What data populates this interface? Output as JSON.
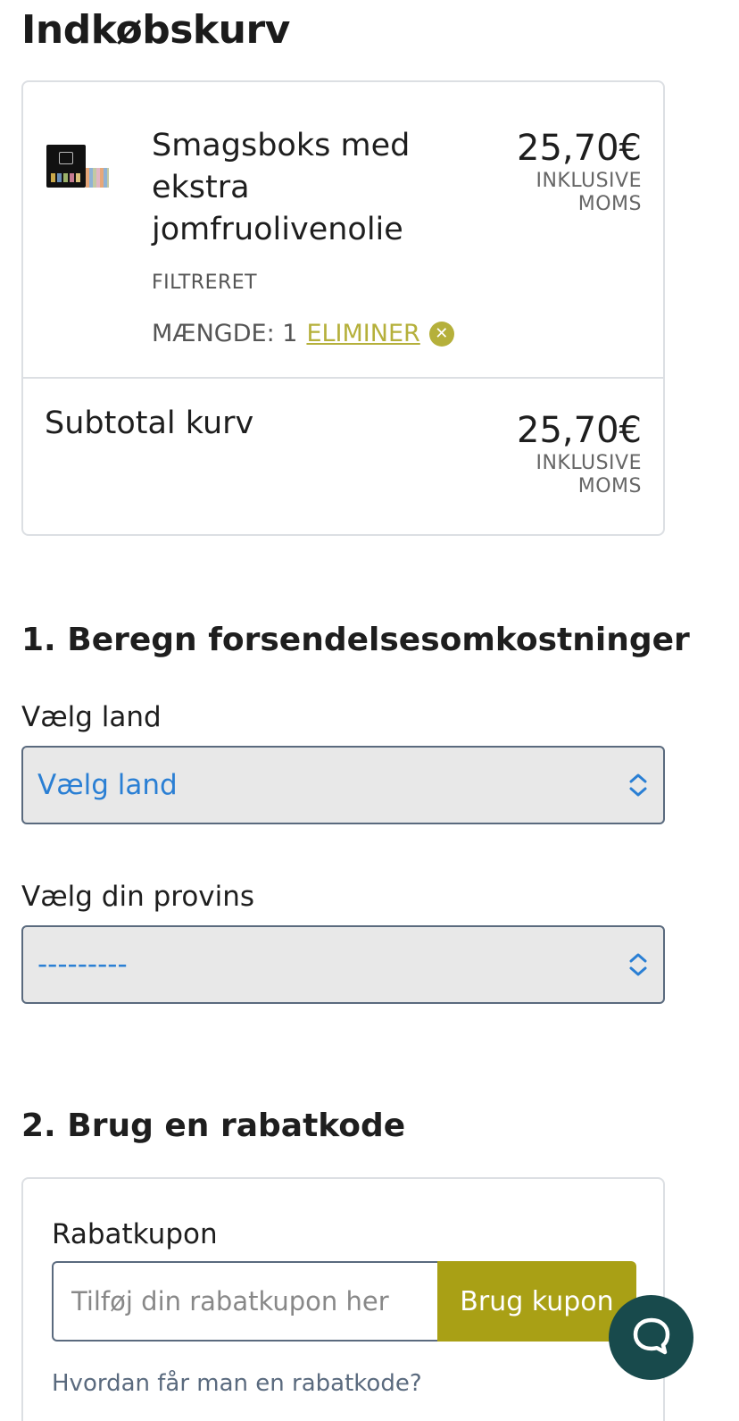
{
  "page": {
    "title": "Indkøbskurv"
  },
  "cart": {
    "item": {
      "name": "Smagsboks med ekstra jomfruolivenolie",
      "variant": "FILTRERET",
      "quantity_label": "MÆNGDE: 1",
      "remove_label": "ELIMINER",
      "price": "25,70€",
      "price_note": "INKLUSIVE MOMS"
    },
    "subtotal": {
      "label": "Subtotal kurv",
      "price": "25,70€",
      "price_note": "INKLUSIVE MOMS"
    }
  },
  "shipping": {
    "title": "1. Beregn forsendelsesomkostninger",
    "country_label": "Vælg land",
    "country_value": "Vælg land",
    "province_label": "Vælg din provins",
    "province_value": "---------"
  },
  "discount": {
    "title": "2. Brug en rabatkode",
    "coupon_label": "Rabatkupon",
    "coupon_placeholder": "Tilføj din rabatkupon her",
    "apply_label": "Brug kupon",
    "help_link": "Hvordan får man en rabatkode?"
  },
  "icons": {
    "remove": "close-circle-icon",
    "select_arrow": "chevron-updown-icon",
    "chat": "chat-bubble-icon"
  },
  "colors": {
    "accent": "#b5b03b",
    "button": "#a9a015",
    "select_text": "#2a7fd4",
    "chat": "#184a4c"
  }
}
